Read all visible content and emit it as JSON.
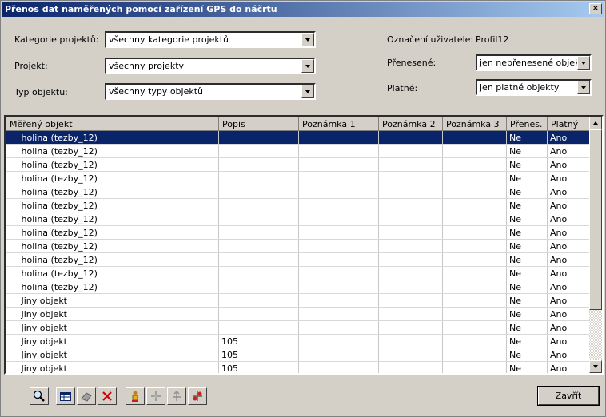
{
  "window": {
    "title": "Přenos dat naměřených pomocí zařízení GPS do náčrtu",
    "close": "×"
  },
  "filters": {
    "kategorie_label": "Kategorie projektů:",
    "kategorie_value": "všechny kategorie projektů",
    "projekt_label": "Projekt:",
    "projekt_value": "všechny projekty",
    "typ_label": "Typ objektu:",
    "typ_value": "všechny typy objektů",
    "uzivatel_label": "Označení uživatele:",
    "uzivatel_value": "Profil12",
    "prenesene_label": "Přenesené:",
    "prenesene_value": "jen nepřenesené objekty",
    "platne_label": "Platné:",
    "platne_value": "jen platné objekty"
  },
  "grid": {
    "columns": [
      "Měřený objekt",
      "Popis",
      "Poznámka 1",
      "Poznámka 2",
      "Poznámka 3",
      "Přenes.",
      "Platný"
    ],
    "rows": [
      [
        "holina (tezby_12)",
        "",
        "",
        "",
        "",
        "Ne",
        "Ano"
      ],
      [
        "holina (tezby_12)",
        "",
        "",
        "",
        "",
        "Ne",
        "Ano"
      ],
      [
        "holina (tezby_12)",
        "",
        "",
        "",
        "",
        "Ne",
        "Ano"
      ],
      [
        "holina (tezby_12)",
        "",
        "",
        "",
        "",
        "Ne",
        "Ano"
      ],
      [
        "holina (tezby_12)",
        "",
        "",
        "",
        "",
        "Ne",
        "Ano"
      ],
      [
        "holina (tezby_12)",
        "",
        "",
        "",
        "",
        "Ne",
        "Ano"
      ],
      [
        "holina (tezby_12)",
        "",
        "",
        "",
        "",
        "Ne",
        "Ano"
      ],
      [
        "holina (tezby_12)",
        "",
        "",
        "",
        "",
        "Ne",
        "Ano"
      ],
      [
        "holina (tezby_12)",
        "",
        "",
        "",
        "",
        "Ne",
        "Ano"
      ],
      [
        "holina (tezby_12)",
        "",
        "",
        "",
        "",
        "Ne",
        "Ano"
      ],
      [
        "holina (tezby_12)",
        "",
        "",
        "",
        "",
        "Ne",
        "Ano"
      ],
      [
        "holina (tezby_12)",
        "",
        "",
        "",
        "",
        "Ne",
        "Ano"
      ],
      [
        "Jiny objekt",
        "",
        "",
        "",
        "",
        "Ne",
        "Ano"
      ],
      [
        "Jiny objekt",
        "",
        "",
        "",
        "",
        "Ne",
        "Ano"
      ],
      [
        "Jiny objekt",
        "",
        "",
        "",
        "",
        "Ne",
        "Ano"
      ],
      [
        "Jiny objekt",
        "105",
        "",
        "",
        "",
        "Ne",
        "Ano"
      ],
      [
        "Jiny objekt",
        "105",
        "",
        "",
        "",
        "Ne",
        "Ano"
      ],
      [
        "Jiny objekt",
        "105",
        "",
        "",
        "",
        "Ne",
        "Ano"
      ]
    ],
    "selected_row": 0
  },
  "toolbar": {
    "icons": [
      "zoom-icon",
      "table-icon",
      "eraser-icon",
      "delete-icon",
      "person-icon",
      "move-icon",
      "move-up-icon",
      "transfer-icon"
    ],
    "close_label": "Zavřít"
  },
  "colors": {
    "selection": "#0a246a",
    "title_start": "#0a246a",
    "title_end": "#a6caf0",
    "delete": "#cc0000"
  }
}
